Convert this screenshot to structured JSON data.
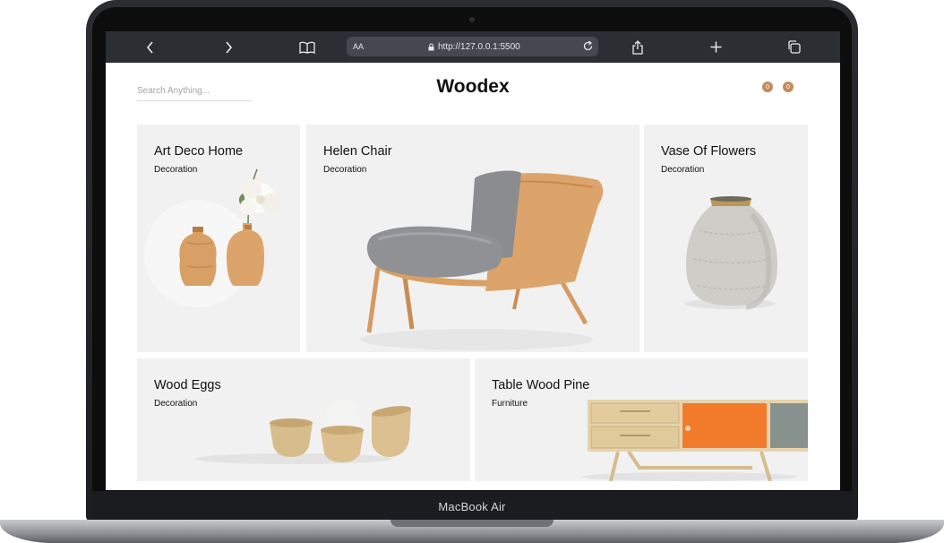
{
  "device": {
    "model_label": "MacBook Air"
  },
  "browser": {
    "text_size_label": "AA",
    "url": "http://127.0.0.1:5500",
    "icons": [
      "back-icon",
      "forward-icon",
      "reader-icon",
      "lock-icon",
      "reload-icon",
      "share-icon",
      "new-tab-icon",
      "tabs-icon"
    ]
  },
  "header": {
    "search_placeholder": "Search Anything...",
    "brand": "Woodex",
    "badges": [
      "0",
      "0"
    ],
    "accent_color": "#c48b5d"
  },
  "products": [
    {
      "title": "Art Deco Home",
      "category": "Decoration"
    },
    {
      "title": "Helen Chair",
      "category": "Decoration"
    },
    {
      "title": "Vase Of Flowers",
      "category": "Decoration"
    },
    {
      "title": "Wood Eggs",
      "category": "Decoration"
    },
    {
      "title": "Table Wood Pine",
      "category": "Furniture"
    }
  ]
}
